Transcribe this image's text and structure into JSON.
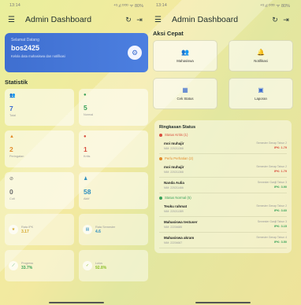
{
  "left": {
    "status": {
      "time": "13:14",
      "signal": "⁴ᴳ.ıl ᴰᴼᴰ ᯤ 80%"
    },
    "appbar": {
      "title": "Admin Dashboard"
    },
    "welcome": {
      "greeting": "Selamat Datang",
      "username": "bos2425",
      "hint": "Kelola data mahasiswa dan notifikasi"
    },
    "stats_title": "Statistik",
    "stats": [
      {
        "icon": "people-icon",
        "glyph": "👥",
        "value": "7",
        "label": "Total",
        "color": "#3b6bd0"
      },
      {
        "icon": "check-circle-icon",
        "glyph": "●",
        "value": "5",
        "label": "Normal",
        "color": "#3aa25a"
      },
      {
        "icon": "warning-icon",
        "glyph": "▲",
        "value": "2",
        "label": "Peringatan",
        "color": "#e28b2a"
      },
      {
        "icon": "alert-icon",
        "glyph": "●",
        "value": "1",
        "label": "Kritis",
        "color": "#d94e3e"
      },
      {
        "icon": "block-icon",
        "glyph": "⊘",
        "value": "0",
        "label": "Cuti",
        "color": "#6b6b6b"
      },
      {
        "icon": "person-icon",
        "glyph": "♟",
        "value": "58",
        "label": "Aktif",
        "color": "#2f8fbf"
      }
    ],
    "stats2": [
      {
        "icon": "star-icon",
        "glyph": "★",
        "title": "Rata IPK",
        "value": "3.17",
        "color": "#d4a72a"
      },
      {
        "icon": "chart-icon",
        "glyph": "▤",
        "title": "Rata Semester",
        "value": "4.6",
        "color": "#2f8fbf"
      },
      {
        "icon": "trend-icon",
        "glyph": "⟋",
        "title": "Progress",
        "value": "33.7%",
        "color": "#3aa25a"
      },
      {
        "icon": "graduate-icon",
        "glyph": "✓",
        "title": "Lulus",
        "value": "92.8%",
        "color": "#8cbf2a"
      }
    ]
  },
  "right": {
    "status": {
      "time": "13:14",
      "signal": "⁴ᴳ.ıl ᴰᴼᴰ ᯤ 80%"
    },
    "appbar": {
      "title": "Admin Dashboard"
    },
    "quick_title": "Aksi Cepat",
    "quick": [
      {
        "icon": "students-icon",
        "glyph": "👥",
        "label": "Mahasiswa",
        "color": "#3b6bd0"
      },
      {
        "icon": "bell-icon",
        "glyph": "🔔",
        "label": "Notifikasi",
        "color": "#3b6bd0"
      },
      {
        "icon": "calendar-status-icon",
        "glyph": "▦",
        "label": "Cek Status",
        "color": "#3b6bd0"
      },
      {
        "icon": "report-icon",
        "glyph": "▣",
        "label": "Laporan",
        "color": "#3b6bd0"
      }
    ],
    "summary_title": "Ringkasan Status",
    "groups": [
      {
        "label": "Status Kritis (1)",
        "color": "#d94e3e",
        "items": [
          {
            "name": "moi muhajir",
            "nim": "NIM: 220211368",
            "sem": "Semester Genap Tahun 2",
            "ipk": "IPK: 1.79",
            "ipk_color": "#d94e3e"
          }
        ]
      },
      {
        "label": "Perlu Perhatian (2)",
        "color": "#e28b2a",
        "items": [
          {
            "name": "moi muhajir",
            "nim": "NIM: 220211368",
            "sem": "Semester Genap Tahun 2",
            "ipk": "IPK: 1.79",
            "ipk_color": "#d94e3e"
          },
          {
            "name": "Nanda Aulia",
            "nim": "NIM: 220211466",
            "sem": "Semester Ganjil Tahun 3",
            "ipk": "IPK: 3.90",
            "ipk_color": "#3aa25a"
          }
        ]
      },
      {
        "label": "Status Normal (5)",
        "color": "#3aa25a",
        "items": [
          {
            "name": "Teuku rahmat",
            "nim": "NIM: 220211389",
            "sem": "Semester Genap Tahun 2",
            "ipk": "IPK: 3.60",
            "ipk_color": "#3aa25a"
          },
          {
            "name": "Mahasiswa testuser",
            "nim": "NIM: 22204685",
            "sem": "Semester Ganjil Tahun 3",
            "ipk": "IPK: 3.15",
            "ipk_color": "#3aa25a"
          },
          {
            "name": "Mahasiswa akram",
            "nim": "NIM: 22204667",
            "sem": "Semester Genap Tahun 4",
            "ipk": "IPK: 3.50",
            "ipk_color": "#3aa25a"
          }
        ]
      }
    ]
  }
}
